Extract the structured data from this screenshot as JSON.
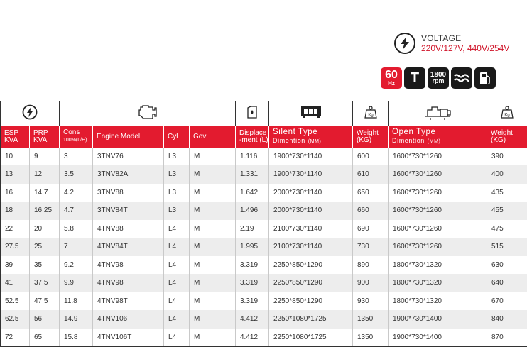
{
  "voltage": {
    "title": "VOLTAGE",
    "values": "220V/127V,  440V/254V",
    "icon": "lightning-icon"
  },
  "badges": {
    "hz_number": "60",
    "hz_unit": "Hz",
    "t_label": "T",
    "rpm_number": "1800",
    "rpm_unit": "rpm",
    "icons": [
      "hertz-icon",
      "t-icon",
      "rpm-icon",
      "water-cooled-icon",
      "fuel-icon"
    ]
  },
  "table": {
    "icon_row": [
      "lightning-icon",
      "engine-icon",
      "fuel-tank-icon",
      "silent-generator-icon",
      "weight-icon",
      "open-generator-icon",
      "weight-icon"
    ],
    "weight_icon_label": "Kg",
    "headers": {
      "esp": "ESP",
      "esp_unit": "KVA",
      "prp": "PRP",
      "prp_unit": "KVA",
      "cons": "Cons",
      "cons_unit": "100%(L/H)",
      "engine": "Engine Model",
      "cyl": "Cyl",
      "gov": "Gov",
      "disp": "Displace",
      "disp_unit": "-ment (L)",
      "silent": "Silent  Type",
      "silent_sub": "Dimention",
      "silent_unit": "(MM)",
      "weight1": "Weight",
      "weight1_unit": "(KG)",
      "open": "Open  Type",
      "open_sub": "Dimention",
      "open_unit": "(MM)",
      "weight2": "Weight",
      "weight2_unit": "(KG)"
    },
    "rows": [
      [
        "10",
        "9",
        "3",
        "3TNV76",
        "L3",
        "M",
        "1.116",
        "1900*730*1140",
        "600",
        "1600*730*1260",
        "390"
      ],
      [
        "13",
        "12",
        "3.5",
        "3TNV82A",
        "L3",
        "M",
        "1.331",
        "1900*730*1140",
        "610",
        "1600*730*1260",
        "400"
      ],
      [
        "16",
        "14.7",
        "4.2",
        "3TNV88",
        "L3",
        "M",
        "1.642",
        "2000*730*1140",
        "650",
        "1600*730*1260",
        "435"
      ],
      [
        "18",
        "16.25",
        "4.7",
        "3TNV84T",
        "L3",
        "M",
        "1.496",
        "2000*730*1140",
        "660",
        "1600*730*1260",
        "455"
      ],
      [
        "22",
        "20",
        "5.8",
        "4TNV88",
        "L4",
        "M",
        "2.19",
        "2100*730*1140",
        "690",
        "1600*730*1260",
        "475"
      ],
      [
        "27.5",
        "25",
        "7",
        "4TNV84T",
        "L4",
        "M",
        "1.995",
        "2100*730*1140",
        "730",
        "1600*730*1260",
        "515"
      ],
      [
        "39",
        "35",
        "9.2",
        "4TNV98",
        "L4",
        "M",
        "3.319",
        "2250*850*1290",
        "890",
        "1800*730*1320",
        "630"
      ],
      [
        "41",
        "37.5",
        "9.9",
        "4TNV98",
        "L4",
        "M",
        "3.319",
        "2250*850*1290",
        "900",
        "1800*730*1320",
        "640"
      ],
      [
        "52.5",
        "47.5",
        "11.8",
        "4TNV98T",
        "L4",
        "M",
        "3.319",
        "2250*850*1290",
        "930",
        "1800*730*1320",
        "670"
      ],
      [
        "62.5",
        "56",
        "14.9",
        "4TNV106",
        "L4",
        "M",
        "4.412",
        "2250*1080*1725",
        "1350",
        "1900*730*1400",
        "840"
      ],
      [
        "72",
        "65",
        "15.8",
        "4TNV106T",
        "L4",
        "M",
        "4.412",
        "2250*1080*1725",
        "1350",
        "1900*730*1400",
        "870"
      ]
    ]
  },
  "colors": {
    "accent": "#e31b2f",
    "badge_dark": "#1a1a1a",
    "row_alt": "#ededed"
  }
}
